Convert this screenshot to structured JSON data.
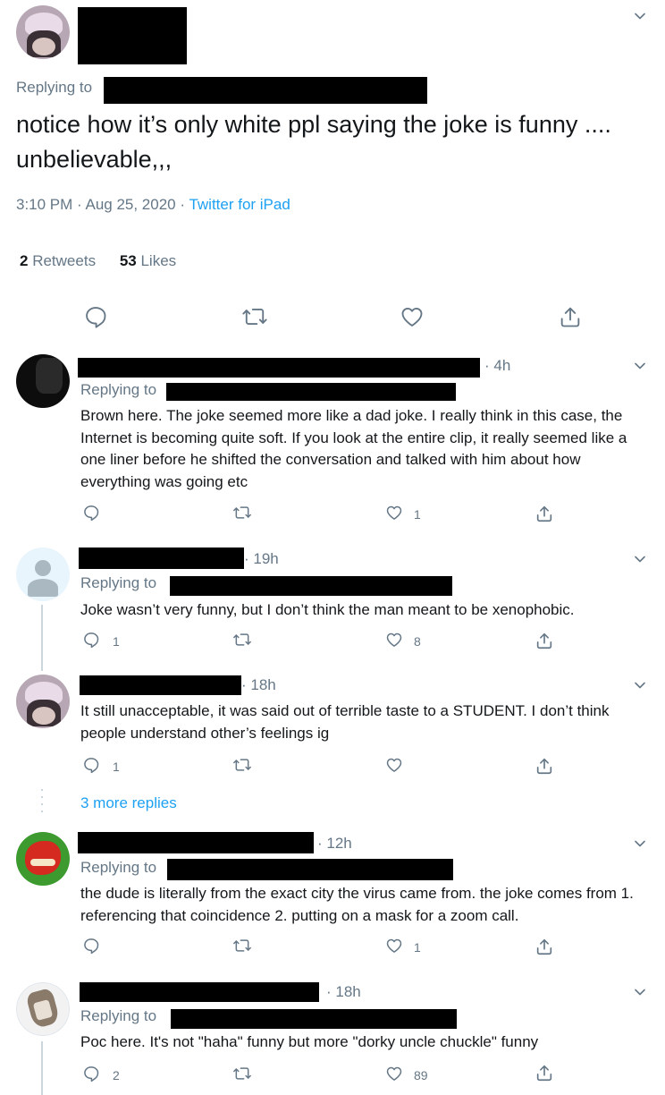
{
  "main": {
    "replying_to": "Replying to",
    "text": "notice how it’s only white ppl saying the joke is funny .... unbelievable,,,",
    "timestamp": "3:10 PM · Aug 25, 2020 · ",
    "source": "Twitter for iPad",
    "retweets_count": "2",
    "retweets_label": "Retweets",
    "likes_count": "53",
    "likes_label": "Likes"
  },
  "replies": [
    {
      "time": "· 4h",
      "replying_to": "Replying to",
      "text": "Brown here. The joke seemed more like a dad joke. I really think in this case, the Internet is becoming quite soft. If you look at the entire clip, it really seemed like a one liner before he shifted the conversation and talked with him about how everything was going etc",
      "reply_count": "",
      "retweet_count": "",
      "like_count": "1"
    },
    {
      "time": "· 19h",
      "replying_to": "Replying to",
      "text": "Joke wasn’t very funny, but I don’t think the man meant to be xenophobic.",
      "reply_count": "1",
      "retweet_count": "",
      "like_count": "8"
    },
    {
      "time": "· 18h",
      "replying_to": "",
      "text": "It still unacceptable, it was said out of terrible taste to a STUDENT. I don’t think people understand other’s feelings ig",
      "reply_count": "1",
      "retweet_count": "",
      "like_count": ""
    },
    {
      "time": "· 12h",
      "replying_to": "Replying to",
      "text": "the dude is literally from the exact city the virus came from. the joke comes from 1. referencing that coincidence 2. putting on a mask for a zoom call.",
      "reply_count": "",
      "retweet_count": "",
      "like_count": "1"
    },
    {
      "time": "· 18h",
      "replying_to": "Replying to",
      "text": "Poc here. It's not \"haha\" funny but more \"dorky uncle chuckle\" funny",
      "reply_count": "2",
      "retweet_count": "",
      "like_count": "89"
    }
  ],
  "more_replies": "3 more replies",
  "colors": {
    "accent": "#1da1f2",
    "secondary_text": "#657786",
    "thread_line": "#ccd6dd"
  }
}
